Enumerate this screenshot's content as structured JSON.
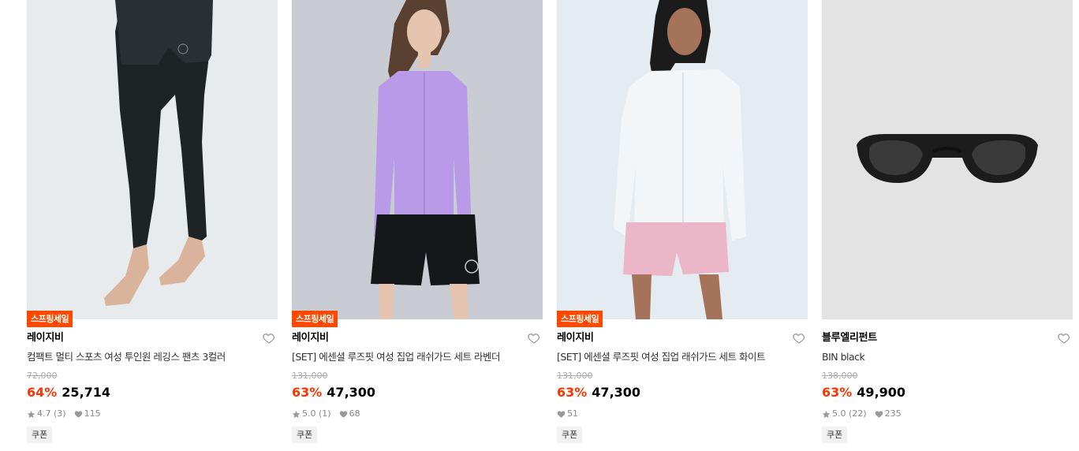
{
  "products": [
    {
      "badge": "스프링세일",
      "brand": "레이지비",
      "name": "컴팩트 멀티 스포츠 여성 투인원 레깅스 팬츠 3컬러",
      "original_price": "72,000",
      "discount": "64%",
      "price": "25,714",
      "rating": "4.7",
      "review_count": "(3)",
      "likes": "115",
      "coupon": "쿠폰",
      "image_alt": "black-leggings-model"
    },
    {
      "badge": "스프링세일",
      "brand": "레이지비",
      "name": "[SET] 에센셜 루즈핏 여성 집업 래쉬가드 세트 라벤더",
      "original_price": "131,000",
      "discount": "63%",
      "price": "47,300",
      "rating": "5.0",
      "review_count": "(1)",
      "likes": "68",
      "coupon": "쿠폰",
      "image_alt": "lavender-rashguard-model"
    },
    {
      "badge": "스프링세일",
      "brand": "레이지비",
      "name": "[SET] 에센셜 루즈핏 여성 집업 래쉬가드 세트 화이트",
      "original_price": "131,000",
      "discount": "63%",
      "price": "47,300",
      "likes": "51",
      "coupon": "쿠폰",
      "image_alt": "white-rashguard-model"
    },
    {
      "brand": "블루엘리펀트",
      "name": "BIN black",
      "original_price": "138,000",
      "discount": "63%",
      "price": "49,900",
      "rating": "5.0",
      "review_count": "(22)",
      "likes": "235",
      "coupon": "쿠폰",
      "image_alt": "black-sunglasses"
    }
  ],
  "colors": {
    "badge_bg": "#ff4800",
    "discount": "#ff3300",
    "muted": "#888888"
  }
}
